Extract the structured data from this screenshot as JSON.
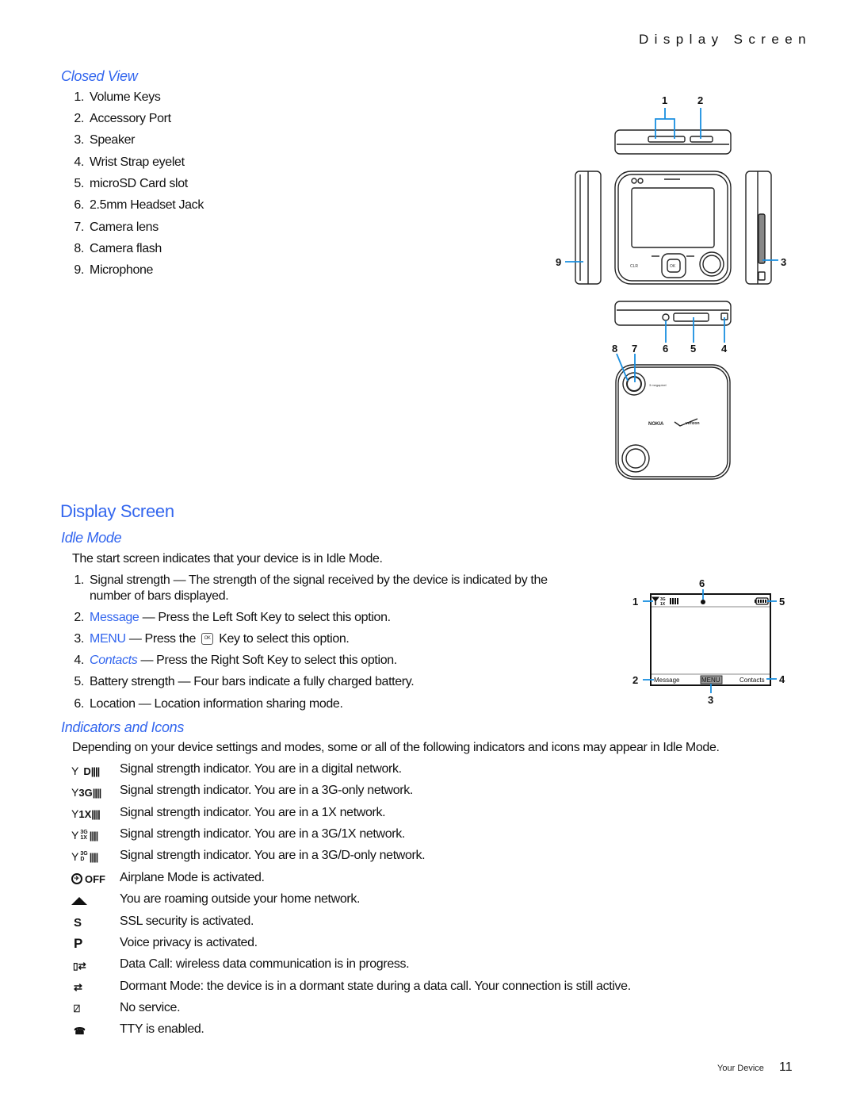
{
  "running_head": "Display Screen",
  "closed_view": {
    "heading": "Closed View",
    "items": [
      {
        "num": "1.",
        "label": "Volume Keys"
      },
      {
        "num": "2.",
        "label": "Accessory Port"
      },
      {
        "num": "3.",
        "label": "Speaker"
      },
      {
        "num": "4.",
        "label": "Wrist Strap eyelet"
      },
      {
        "num": "5.",
        "label": "microSD Card slot"
      },
      {
        "num": "6.",
        "label": "2.5mm Headset Jack"
      },
      {
        "num": "7.",
        "label": "Camera lens"
      },
      {
        "num": "8.",
        "label": "Camera flash"
      },
      {
        "num": "9.",
        "label": "Microphone"
      }
    ],
    "diagram": {
      "callouts": [
        "1",
        "2",
        "3",
        "4",
        "5",
        "6",
        "7",
        "8",
        "9"
      ],
      "front_key_clr": "CLR",
      "front_key_ok": "OK",
      "back_camera_label": "3 megapixel",
      "back_brand_1": "NOKIA",
      "back_brand_2": "verizon"
    }
  },
  "display_screen": {
    "heading": "Display Screen",
    "idle_mode": {
      "heading": "Idle Mode",
      "intro": "The start screen indicates that your device is in Idle Mode.",
      "items": [
        {
          "num": "1.",
          "lead": "Signal strength",
          "text": " — The strength of the signal received by the device is indicated by the",
          "text2": "number of bars displayed."
        },
        {
          "num": "2.",
          "lead": "Message",
          "text": " — Press the Left Soft Key to select this option."
        },
        {
          "num": "3.",
          "lead": "MENU",
          "text_a": " — Press the ",
          "key": "OK",
          "text_b": " Key to select this option."
        },
        {
          "num": "4.",
          "lead": "Contacts",
          "text": " — Press the Right Soft Key to select this option."
        },
        {
          "num": "5.",
          "lead": "Battery strength",
          "text": " — Four bars indicate a fully charged battery."
        },
        {
          "num": "6.",
          "lead": "Location",
          "text": " — Location information sharing mode."
        }
      ],
      "screen_diagram": {
        "callouts": [
          "1",
          "2",
          "3",
          "4",
          "5",
          "6"
        ],
        "left_softkey": "Message",
        "center_softkey": "MENU",
        "right_softkey": "Contacts",
        "network_top": "3G",
        "network_bottom": "1X"
      }
    },
    "indicators": {
      "heading": "Indicators and Icons",
      "intro": "Depending on your device settings and modes, some or all of the following indicators and icons may appear in Idle Mode.",
      "items": [
        {
          "icon": "signal-digital-icon",
          "glyph": "D",
          "text": "Signal strength indicator. You are in a digital network."
        },
        {
          "icon": "signal-3g-icon",
          "glyph": "3G",
          "text": "Signal strength indicator. You are in a 3G-only network."
        },
        {
          "icon": "signal-1x-icon",
          "glyph": "1X",
          "text": "Signal strength indicator. You are in a 1X network."
        },
        {
          "icon": "signal-3g-1x-icon",
          "glyph_top": "3G",
          "glyph_bottom": "1X",
          "text": "Signal strength indicator. You are in a 3G/1X network."
        },
        {
          "icon": "signal-3g-d-icon",
          "glyph_top": "3G",
          "glyph_bottom": "D",
          "text": "Signal strength indicator. You are in a 3G/D-only network."
        },
        {
          "icon": "airplane-mode-icon",
          "glyph": "OFF",
          "text": "Airplane Mode is activated."
        },
        {
          "icon": "roaming-icon",
          "text": "You are roaming outside your home network."
        },
        {
          "icon": "ssl-security-icon",
          "glyph": "S",
          "text": "SSL security is activated."
        },
        {
          "icon": "voice-privacy-icon",
          "glyph": "P",
          "text": "Voice privacy is activated."
        },
        {
          "icon": "data-call-icon",
          "text": "Data Call: wireless data communication is in progress."
        },
        {
          "icon": "dormant-mode-icon",
          "text": "Dormant Mode: the device is in a dormant state during a data call. Your connection is still active."
        },
        {
          "icon": "no-service-icon",
          "text": "No service."
        },
        {
          "icon": "tty-icon",
          "text": "TTY is enabled."
        }
      ]
    }
  },
  "footer": {
    "section": "Your Device",
    "page": "11"
  },
  "colors": {
    "heading_blue": "#3366ee",
    "callout_blue": "#1a8fe0",
    "text": "#111111"
  }
}
